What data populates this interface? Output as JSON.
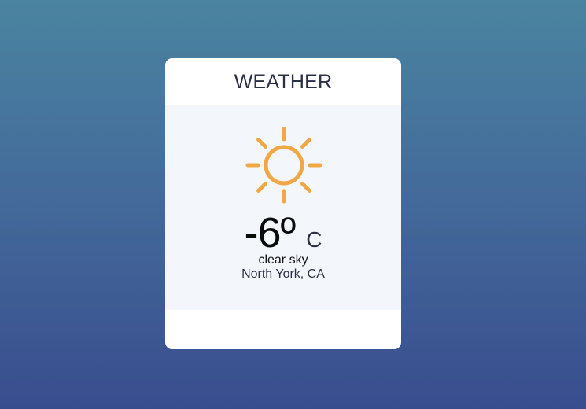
{
  "weather": {
    "title": "WEATHER",
    "icon": "sun-icon",
    "temperature": "-6º",
    "unit": "C",
    "condition": "clear sky",
    "location": "North York, CA"
  },
  "colors": {
    "background_top": "#4a84a0",
    "background_bottom": "#394d8e",
    "card": "#ffffff",
    "card_body": "#f3f6fb",
    "sun": "#f0a844",
    "title_text": "#2b3047"
  }
}
